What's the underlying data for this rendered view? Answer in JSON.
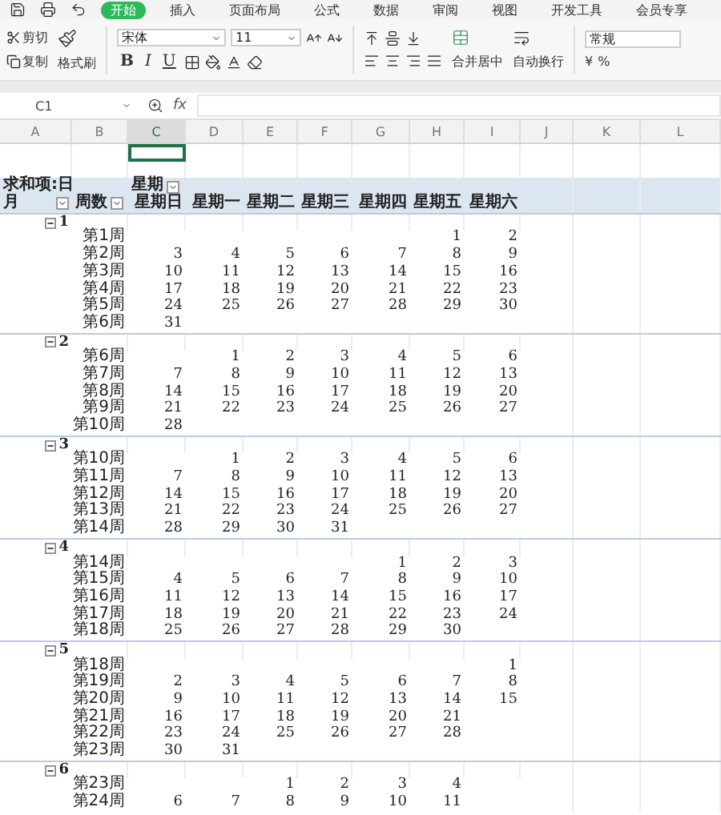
{
  "menu_tabs": [
    {
      "label": "开始",
      "selected": true
    },
    {
      "label": "插入",
      "selected": false
    },
    {
      "label": "页面布局",
      "selected": false
    },
    {
      "label": "公式",
      "selected": false
    },
    {
      "label": "数据",
      "selected": false
    },
    {
      "label": "审阅",
      "selected": false
    },
    {
      "label": "视图",
      "selected": false
    },
    {
      "label": "开发工具",
      "selected": false
    },
    {
      "label": "会员专享",
      "selected": false
    }
  ],
  "ribbon": {
    "clipboard": [
      "剪切",
      "复制"
    ],
    "format_painter": "格式刷",
    "font_name": "宋体",
    "font_size": "11",
    "format_buttons": [
      "B",
      "I",
      "U"
    ],
    "merge_button": "合并居中",
    "wrap_button": "自动换行",
    "number_format": "常规",
    "number_buttons": [
      "¥",
      "%"
    ]
  },
  "formula_bar": {
    "name_box": "C1",
    "fx": "fx"
  },
  "columns": [
    {
      "label": "A",
      "selected": false
    },
    {
      "label": "B",
      "selected": false
    },
    {
      "label": "C",
      "selected": true
    },
    {
      "label": "D",
      "selected": false
    },
    {
      "label": "E",
      "selected": false
    },
    {
      "label": "F",
      "selected": false
    },
    {
      "label": "G",
      "selected": false
    },
    {
      "label": "H",
      "selected": false
    },
    {
      "label": "I",
      "selected": false
    },
    {
      "label": "J",
      "selected": false
    },
    {
      "label": "K",
      "selected": false
    },
    {
      "label": "L",
      "selected": false
    }
  ],
  "pivot": {
    "value_label": "求和项:日",
    "column_field": "星期",
    "row_fields": [
      "月",
      "周数"
    ],
    "weekdays": [
      "星期日",
      "星期一",
      "星期二",
      "星期三",
      "星期四",
      "星期五",
      "星期六"
    ],
    "months": [
      {
        "label": "1",
        "weeks": [
          {
            "label": "第1周",
            "days": {
              "fri": "1",
              "sat": "2"
            }
          },
          {
            "label": "第2周",
            "days": {
              "sun": "3",
              "mon": "4",
              "tue": "5",
              "wed": "6",
              "thu": "7",
              "fri": "8",
              "sat": "9"
            }
          },
          {
            "label": "第3周",
            "days": {
              "sun": "10",
              "mon": "11",
              "tue": "12",
              "wed": "13",
              "thu": "14",
              "fri": "15",
              "sat": "16"
            }
          },
          {
            "label": "第4周",
            "days": {
              "sun": "17",
              "mon": "18",
              "tue": "19",
              "wed": "20",
              "thu": "21",
              "fri": "22",
              "sat": "23"
            }
          },
          {
            "label": "第5周",
            "days": {
              "sun": "24",
              "mon": "25",
              "tue": "26",
              "wed": "27",
              "thu": "28",
              "fri": "29",
              "sat": "30"
            }
          },
          {
            "label": "第6周",
            "days": {
              "sun": "31"
            }
          }
        ]
      },
      {
        "label": "2",
        "weeks": [
          {
            "label": "第6周",
            "days": {
              "mon": "1",
              "tue": "2",
              "wed": "3",
              "thu": "4",
              "fri": "5",
              "sat": "6"
            }
          },
          {
            "label": "第7周",
            "days": {
              "sun": "7",
              "mon": "8",
              "tue": "9",
              "wed": "10",
              "thu": "11",
              "fri": "12",
              "sat": "13"
            }
          },
          {
            "label": "第8周",
            "days": {
              "sun": "14",
              "mon": "15",
              "tue": "16",
              "wed": "17",
              "thu": "18",
              "fri": "19",
              "sat": "20"
            }
          },
          {
            "label": "第9周",
            "days": {
              "sun": "21",
              "mon": "22",
              "tue": "23",
              "wed": "24",
              "thu": "25",
              "fri": "26",
              "sat": "27"
            }
          },
          {
            "label": "第10周",
            "days": {
              "sun": "28"
            }
          }
        ]
      },
      {
        "label": "3",
        "weeks": [
          {
            "label": "第10周",
            "days": {
              "mon": "1",
              "tue": "2",
              "wed": "3",
              "thu": "4",
              "fri": "5",
              "sat": "6"
            }
          },
          {
            "label": "第11周",
            "days": {
              "sun": "7",
              "mon": "8",
              "tue": "9",
              "wed": "10",
              "thu": "11",
              "fri": "12",
              "sat": "13"
            }
          },
          {
            "label": "第12周",
            "days": {
              "sun": "14",
              "mon": "15",
              "tue": "16",
              "wed": "17",
              "thu": "18",
              "fri": "19",
              "sat": "20"
            }
          },
          {
            "label": "第13周",
            "days": {
              "sun": "21",
              "mon": "22",
              "tue": "23",
              "wed": "24",
              "thu": "25",
              "fri": "26",
              "sat": "27"
            }
          },
          {
            "label": "第14周",
            "days": {
              "sun": "28",
              "mon": "29",
              "tue": "30",
              "wed": "31"
            }
          }
        ]
      },
      {
        "label": "4",
        "weeks": [
          {
            "label": "第14周",
            "days": {
              "thu": "1",
              "fri": "2",
              "sat": "3"
            }
          },
          {
            "label": "第15周",
            "days": {
              "sun": "4",
              "mon": "5",
              "tue": "6",
              "wed": "7",
              "thu": "8",
              "fri": "9",
              "sat": "10"
            }
          },
          {
            "label": "第16周",
            "days": {
              "sun": "11",
              "mon": "12",
              "tue": "13",
              "wed": "14",
              "thu": "15",
              "fri": "16",
              "sat": "17"
            }
          },
          {
            "label": "第17周",
            "days": {
              "sun": "18",
              "mon": "19",
              "tue": "20",
              "wed": "21",
              "thu": "22",
              "fri": "23",
              "sat": "24"
            }
          },
          {
            "label": "第18周",
            "days": {
              "sun": "25",
              "mon": "26",
              "tue": "27",
              "wed": "28",
              "thu": "29",
              "fri": "30"
            }
          }
        ]
      },
      {
        "label": "5",
        "weeks": [
          {
            "label": "第18周",
            "days": {
              "sat": "1"
            }
          },
          {
            "label": "第19周",
            "days": {
              "sun": "2",
              "mon": "3",
              "tue": "4",
              "wed": "5",
              "thu": "6",
              "fri": "7",
              "sat": "8"
            }
          },
          {
            "label": "第20周",
            "days": {
              "sun": "9",
              "mon": "10",
              "tue": "11",
              "wed": "12",
              "thu": "13",
              "fri": "14",
              "sat": "15"
            }
          },
          {
            "label": "第21周",
            "days": {
              "sun": "16",
              "mon": "17",
              "tue": "18",
              "wed": "19",
              "thu": "20",
              "fri": "21"
            }
          },
          {
            "label": "第22周",
            "days": {
              "sun": "23",
              "mon": "24",
              "tue": "25",
              "wed": "26",
              "thu": "27",
              "fri": "28"
            }
          },
          {
            "label": "第23周",
            "days": {
              "sun": "30",
              "mon": "31"
            }
          }
        ]
      },
      {
        "label": "6",
        "weeks": [
          {
            "label": "第23周",
            "days": {
              "tue": "1",
              "wed": "2",
              "thu": "3",
              "fri": "4"
            }
          },
          {
            "label": "第24周",
            "days": {
              "sun": "6",
              "mon": "7",
              "tue": "8",
              "wed": "9",
              "thu": "10",
              "fri": "11"
            }
          }
        ]
      }
    ]
  }
}
